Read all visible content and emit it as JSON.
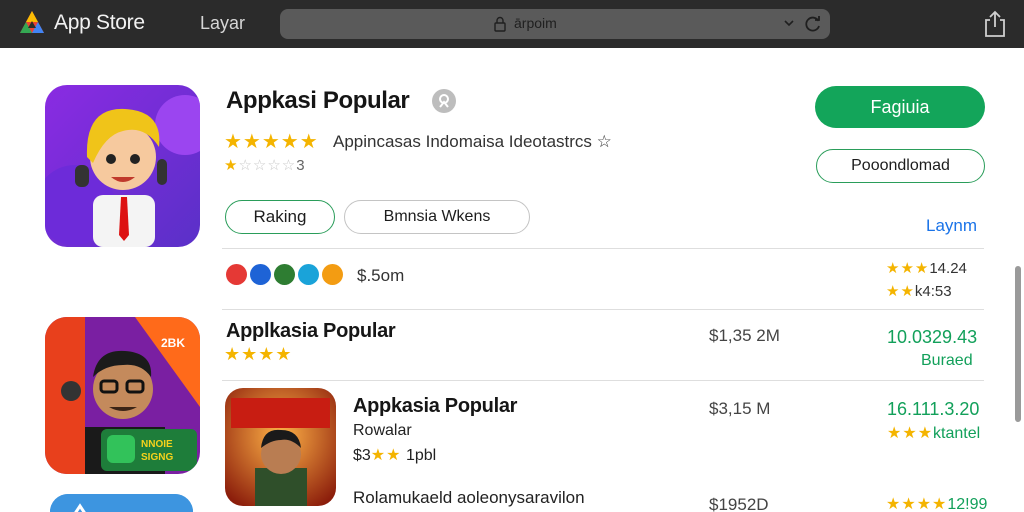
{
  "topbar": {
    "brand": "App Store",
    "nav_label": "Layar",
    "url": "ārpoim",
    "icons": [
      "app-logo-icon",
      "lock-icon",
      "chevron-down-icon",
      "reload-icon",
      "share-icon"
    ]
  },
  "featured": {
    "title": "Appkasi Popular",
    "stars": "★★★★★",
    "subtitle": "Appincasas Indomaisa Ideotastrcs ☆",
    "stars2_filled": "★",
    "stars2_empty": "☆☆☆☆",
    "rating_count": "3",
    "tag_rank": "Raking",
    "tag_browse": "Bmnsia Wkens",
    "get_label": "Fagiuia",
    "download_label": "Pooondlomad",
    "see_link": "Laynm",
    "price": "$.5om",
    "stat1_stars": "★★★",
    "stat1": "14.24",
    "stat2_stars": "★★",
    "stat2": "k4:53"
  },
  "list": [
    {
      "title": "Applkasia Popular",
      "stars": "★★★★",
      "price": "$1,35 2M",
      "value": "10.0329.43",
      "action": "Buraed"
    },
    {
      "title": "Appkasia Popular",
      "subtitle": "Rowalar",
      "price_tag": "$3",
      "stars": "★★",
      "extra": "1pbl",
      "price": "$3,15 M",
      "value": "16.111.3.20",
      "stars_right": "★★★",
      "action": "ktantel"
    },
    {
      "title": "Rolamukaeld aoleonysaravilon",
      "price": "$1952D",
      "stars": "★★★★",
      "value": "12!99"
    }
  ],
  "colors": {
    "topbar": "#2b2b2b",
    "accent_green": "#13a55a",
    "link_blue": "#1a73e8",
    "star_gold": "#f4b400"
  }
}
